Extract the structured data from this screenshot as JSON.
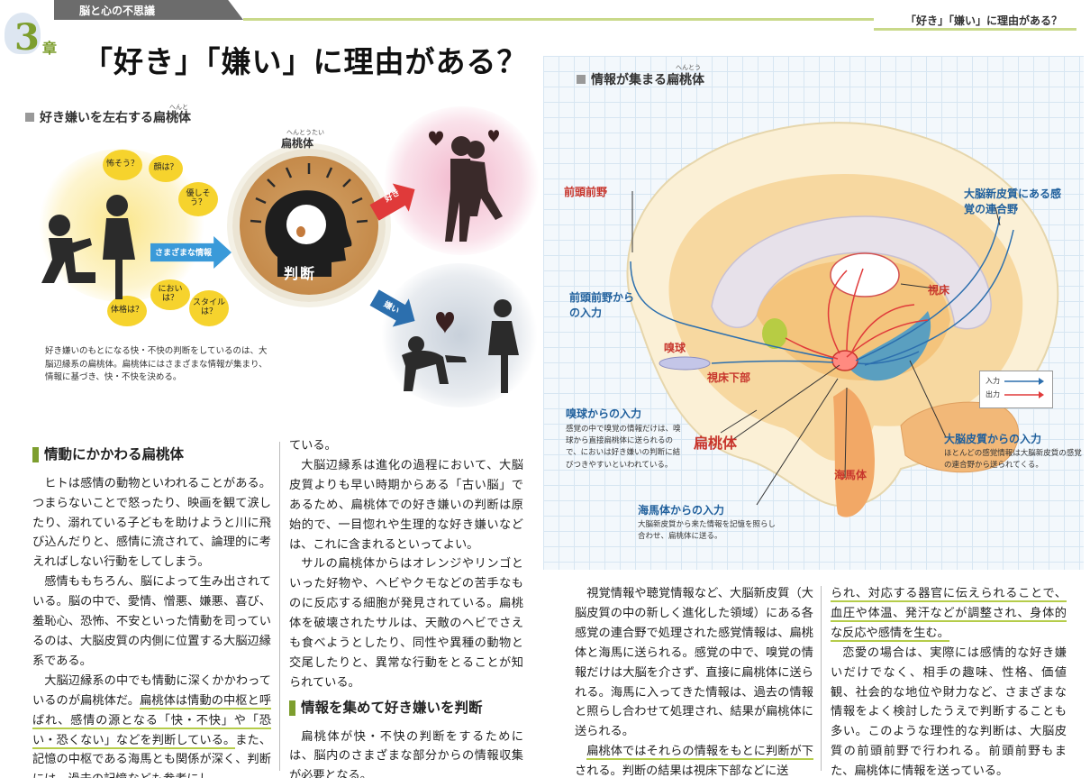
{
  "header": {
    "series": "脳と心の不思議",
    "right_title": "「好き」「嫌い」に理由がある？",
    "chapter_number": "3",
    "chapter_suffix": "章",
    "main_title": "「好き」「嫌い」に理由がある？"
  },
  "left_figure": {
    "title": "好き嫌いを左右する扁桃体",
    "title_ruby": "へんとうたい",
    "bubbles": [
      "怖そう？",
      "顔は？",
      "優しそう？",
      "においは？",
      "スタイルは？",
      "体格は？"
    ],
    "info_arrow": "さまざまな情報",
    "amygdala_ruby": "へんとうたい",
    "amygdala": "扁桃体",
    "judgment": "判断",
    "like": "好き",
    "dislike": "嫌い",
    "caption": "好き嫌いのもとになる快・不快の判断をしているのは、大脳辺縁系の扁桃体。扁桃体にはさまざまな情報が集まり、情報に基づき、快・不快を決める。"
  },
  "article": {
    "h1": "情動にかかわる扁桃体",
    "col1_p1": "ヒトは感情の動物といわれることがある。つまらないことで怒ったり、映画を観て涙したり、溺れている子どもを助けようと川に飛び込んだりと、感情に流されて、論理的に考えればしない行動をしてしまう。",
    "col1_p2": "感情ももちろん、脳によって生み出されている。脳の中で、愛情、憎悪、嫌悪、喜び、羞恥心、恐怖、不安といった情動を司っているのは、大脳皮質の内側に位置する大脳辺縁系である。",
    "col1_p3a": "大脳辺縁系の中でも情動に深くかかわっているのが扁桃体だ。",
    "col1_p3_hl": "扁桃体は情動の中枢と呼ばれ、感情の源となる「快・不快」や「恐い・恐くない」などを判断している。",
    "col1_p3b": "また、記憶の中枢である海馬とも関係が深く、判断には、過去の記憶なども参考にし",
    "col2_p0": "ている。",
    "col2_p1": "大脳辺縁系は進化の過程において、大脳皮質よりも早い時期からある「古い脳」であるため、扁桃体での好き嫌いの判断は原始的で、一目惚れや生理的な好き嫌いなどは、これに含まれるといってよい。",
    "col2_p2": "サルの扁桃体からはオレンジやリンゴといった好物や、ヘビやクモなどの苦手なものに反応する細胞が発見されている。扁桃体を破壊されたサルは、天敵のヘビでさえも食べようとしたり、同性や異種の動物と交尾したりと、異常な行動をとることが知られている。",
    "h2": "情報を集めて好き嫌いを判断",
    "col2_p3": "扁桃体が快・不快の判断をするためには、脳内のさまざまな部分からの情報収集が必要となる。",
    "col3_p1": "視覚情報や聴覚情報など、大脳新皮質（大脳皮質の中の新しく進化した領域）にある各感覚の連合野で処理された感覚情報は、扁桃体と海馬に送られる。感覚の中で、嗅覚の情報だけは大脳を介さず、直接に扁桃体に送られる。海馬に入ってきた情報は、過去の情報と照らし合わせて処理され、結果が扁桃体に送られる。",
    "col3_p2_hl": "扁桃体ではそれらの情報をもとに判断が下される。",
    "col3_p2b": "判断の結果は視床下部などに送",
    "col4_p0_hl": "られ、対応する器官に伝えられることで、血圧や体温、発汗などが調整され、身体的な反応や感情を生む。",
    "col4_p1": "恋愛の場合は、実際には感情的な好き嫌いだけでなく、相手の趣味、性格、価値観、社会的な地位や財力など、さまざまな情報をよく検討したうえで判断することも多い。このような理性的な判断は、大脳皮質の前頭前野で行われる。前頭前野もまた、扁桃体に情報を送っている。"
  },
  "right_figure": {
    "title": "情報が集まる扁桃体",
    "title_ruby": "へんとうたい",
    "labels": {
      "prefrontal": "前頭前野",
      "association": "大脳新皮質にある感覚の連合野",
      "from_prefrontal": "前頭前野からの入力",
      "thalamus": "視床",
      "olfactory_bulb": "嗅球",
      "hypothalamus": "視床下部",
      "amygdala": "扁桃体",
      "hippocampus": "海馬体"
    },
    "olfactory_input": {
      "title": "嗅球からの入力",
      "text": "感覚の中で嗅覚の情報だけは、嗅球から直接扁桃体に送られるので、においは好き嫌いの判断に結びつきやすいといわれている。"
    },
    "cortex_input": {
      "title": "大脳皮質からの入力",
      "text": "ほとんどの感覚情報は大脳新皮質の感覚の連合野から送られてくる。"
    },
    "hippocampus_input": {
      "title": "海馬体からの入力",
      "text": "大脳新皮質から来た情報を記憶を照らし合わせ、扁桃体に送る。"
    },
    "legend": {
      "input": "入力",
      "output": "出力"
    },
    "colors": {
      "input": "#2c6fae",
      "output": "#e03a3a"
    }
  }
}
